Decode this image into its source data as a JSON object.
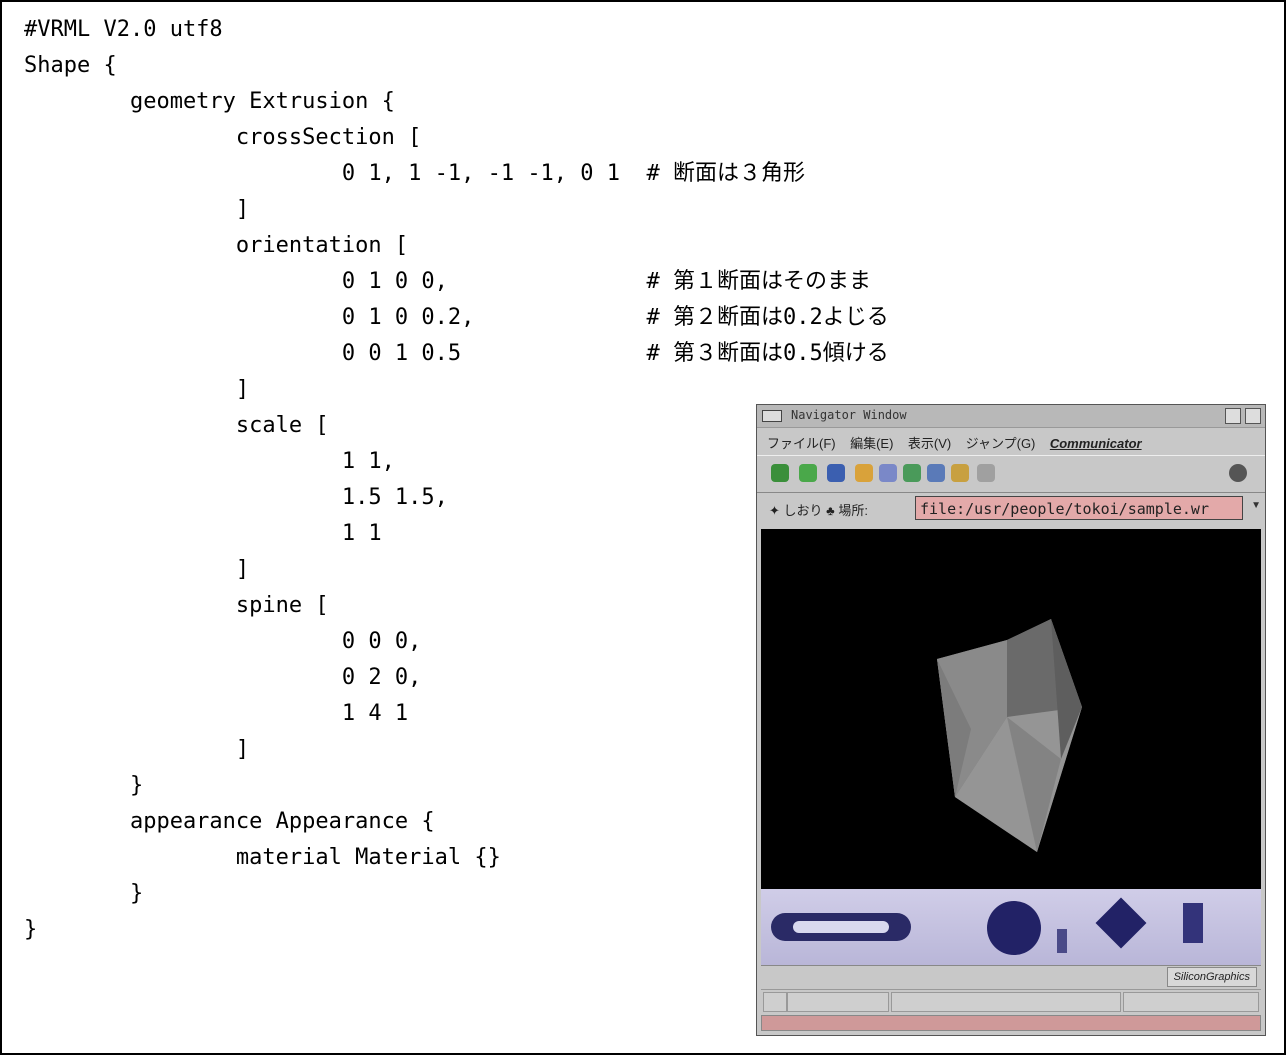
{
  "code_lines": [
    "#VRML V2.0 utf8",
    "Shape {",
    "        geometry Extrusion {",
    "                crossSection [",
    "                        0 1, 1 -1, -1 -1, 0 1  # 断面は３角形",
    "                ]",
    "                orientation [",
    "                        0 1 0 0,               # 第１断面はそのまま",
    "                        0 1 0 0.2,             # 第２断面は0.2よじる",
    "                        0 0 1 0.5              # 第３断面は0.5傾ける",
    "                ]",
    "                scale [",
    "                        1 1,",
    "                        1.5 1.5,",
    "                        1 1",
    "                ]",
    "                spine [",
    "                        0 0 0,",
    "                        0 2 0,",
    "                        1 4 1",
    "                ]",
    "        }",
    "        appearance Appearance {",
    "                material Material {}",
    "        }",
    "}"
  ],
  "navigator": {
    "title": "Navigator Window",
    "menu": [
      "ファイル(F)",
      "編集(E)",
      "表示(V)",
      "ジャンプ(G)",
      "Communicator"
    ],
    "bookmarks_label": "しおり",
    "location_label": "場所:",
    "url": "file:/usr/people/tokoi/sample.wr",
    "brand": "SiliconGraphics"
  },
  "colors": {
    "url_field": "#e3a9a9",
    "viewport_bg": "#000000",
    "controls_bg": "#c4c1e0",
    "bottom_bar": "#cf9999"
  },
  "icons": [
    "back-icon",
    "forward-icon",
    "reload-icon",
    "home-icon",
    "search-icon",
    "netscape-icon",
    "print-icon",
    "security-icon",
    "stop-icon",
    "throbber-icon",
    "bookmark-icon",
    "location-icon"
  ]
}
